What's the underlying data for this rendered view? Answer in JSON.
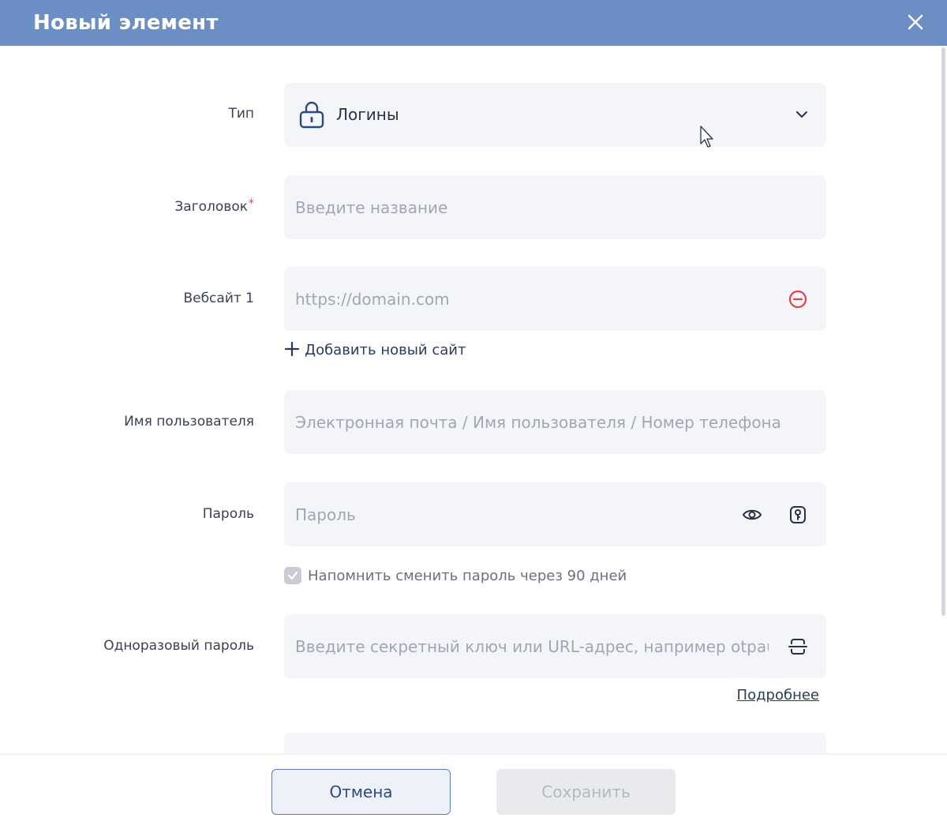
{
  "window": {
    "title": "Новый элемент",
    "close_icon": "close-icon"
  },
  "form": {
    "type": {
      "label": "Тип",
      "value": "Логины",
      "icon": "lock-icon"
    },
    "title": {
      "label": "Заголовок",
      "required_mark": "*",
      "placeholder": "Введите название"
    },
    "website": {
      "label": "Вебсайт 1",
      "placeholder": "https://domain.com",
      "remove_icon": "remove-circle-icon"
    },
    "add_site_label": "Добавить новый сайт",
    "username": {
      "label": "Имя пользователя",
      "placeholder": "Электронная почта / Имя пользователя / Номер телефона"
    },
    "password": {
      "label": "Пароль",
      "placeholder": "Пароль",
      "show_icon": "eye-icon",
      "generate_icon": "key-icon"
    },
    "reminder": {
      "label": "Напомнить сменить пароль через 90 дней",
      "checked": true
    },
    "otp": {
      "label": "Одноразовый пароль",
      "placeholder": "Введите секретный ключ или URL-адрес, например otpau",
      "scan_icon": "scan-icon"
    },
    "details_link": "Подробнее"
  },
  "footer": {
    "cancel_label": "Отмена",
    "save_label": "Сохранить"
  },
  "colors": {
    "titlebar": "#6b8ec5",
    "field_bg": "#f4f5f9",
    "required": "#e0434b",
    "remove": "#e0434b"
  }
}
